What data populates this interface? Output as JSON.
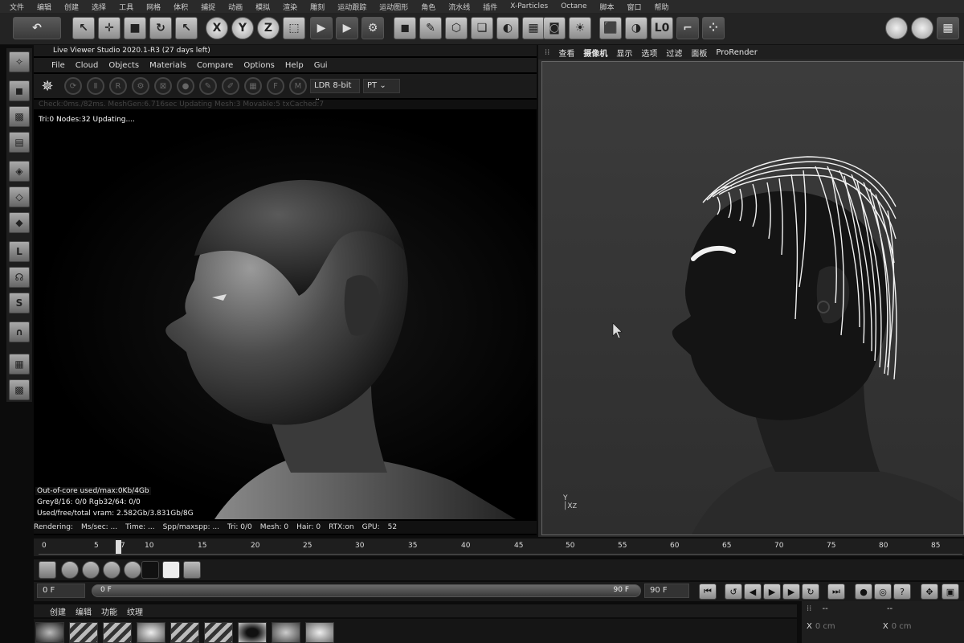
{
  "menubar": [
    "文件",
    "编辑",
    "创建",
    "选择",
    "工具",
    "网格",
    "体积",
    "捕捉",
    "动画",
    "模拟",
    "渲染",
    "雕刻",
    "运动跟踪",
    "运动图形",
    "角色",
    "流水线",
    "插件",
    "X-Particles",
    "Octane",
    "脚本",
    "窗口",
    "帮助"
  ],
  "live_viewer": {
    "title": "Live Viewer Studio 2020.1-R3 (27 days left)",
    "menu": [
      "File",
      "Cloud",
      "Objects",
      "Materials",
      "Compare",
      "Options",
      "Help",
      "Gui"
    ],
    "ldr_select": "LDR 8-bit",
    "pt_select": "PT",
    "status": "Check:0ms./82ms. MeshGen:6.716sec Updating Mesh:3 Movable:5 txCached:7",
    "info": "Tri:0 Nodes:32  Updating....",
    "stats": [
      "Out-of-core used/max:0Kb/4Gb",
      "Grey8/16: 0/0         Rgb32/64: 0/0",
      "Used/free/total vram: 2.582Gb/3.831Gb/8G"
    ],
    "bottom": [
      "Rendering:",
      "Ms/sec: ...",
      "Time: ...",
      "Spp/maxspp: ...",
      "Tri: 0/0",
      "Mesh: 0",
      "Hair: 0",
      "RTX:on",
      "GPU:",
      "52"
    ]
  },
  "viewport": {
    "menu": [
      "查看",
      "摄像机",
      "显示",
      "选项",
      "过滤",
      "面板",
      "ProRender"
    ],
    "axis_y": "Y",
    "axis_x": "X",
    "axis_z": "Z"
  },
  "timeline": {
    "ticks": [
      "0",
      "5",
      "7",
      "10",
      "15",
      "20",
      "25",
      "30",
      "35",
      "40",
      "45",
      "50",
      "55",
      "60",
      "65",
      "70",
      "75",
      "80",
      "85"
    ],
    "current_frame": 7
  },
  "frames": {
    "start": "0 F",
    "slider_start": "0 F",
    "slider_end": "90 F",
    "end": "90 F"
  },
  "materials": {
    "menu": [
      "创建",
      "编辑",
      "功能",
      "纹理"
    ]
  },
  "coords": {
    "x_label_1": "X",
    "x_value_1": "0 cm",
    "x_label_2": "X",
    "x_value_2": "0 cm",
    "dash_1": "--",
    "dash_2": "--"
  },
  "colors": {
    "background": "#0c0c0c",
    "panel": "#1e1e1e",
    "viewport": "#333333",
    "hair": "#f2f2f2"
  }
}
